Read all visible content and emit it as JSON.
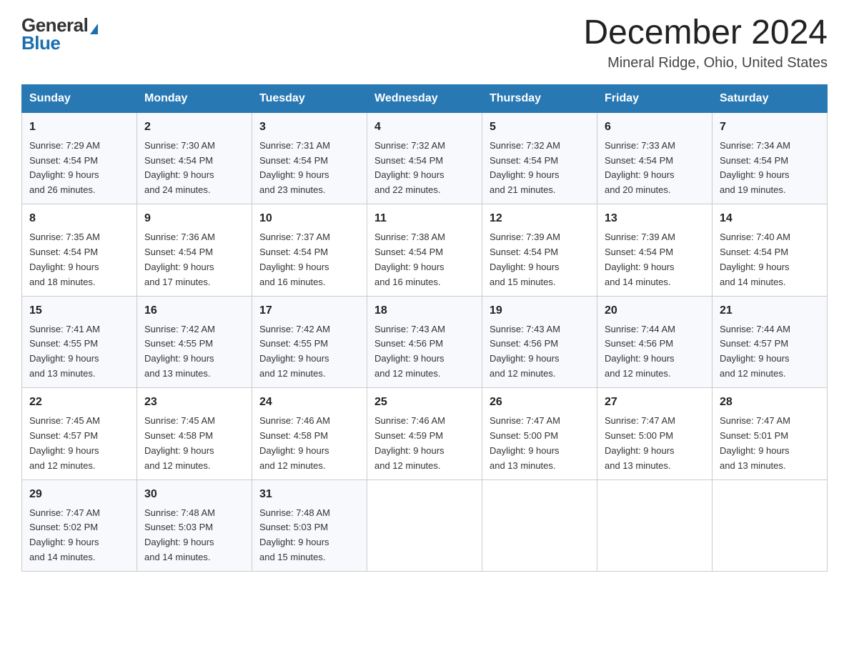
{
  "header": {
    "logo_general": "General",
    "logo_triangle": "▶",
    "logo_blue": "Blue",
    "month_title": "December 2024",
    "location": "Mineral Ridge, Ohio, United States"
  },
  "days_of_week": [
    "Sunday",
    "Monday",
    "Tuesday",
    "Wednesday",
    "Thursday",
    "Friday",
    "Saturday"
  ],
  "weeks": [
    [
      {
        "day": "1",
        "sunrise": "7:29 AM",
        "sunset": "4:54 PM",
        "daylight": "9 hours and 26 minutes."
      },
      {
        "day": "2",
        "sunrise": "7:30 AM",
        "sunset": "4:54 PM",
        "daylight": "9 hours and 24 minutes."
      },
      {
        "day": "3",
        "sunrise": "7:31 AM",
        "sunset": "4:54 PM",
        "daylight": "9 hours and 23 minutes."
      },
      {
        "day": "4",
        "sunrise": "7:32 AM",
        "sunset": "4:54 PM",
        "daylight": "9 hours and 22 minutes."
      },
      {
        "day": "5",
        "sunrise": "7:32 AM",
        "sunset": "4:54 PM",
        "daylight": "9 hours and 21 minutes."
      },
      {
        "day": "6",
        "sunrise": "7:33 AM",
        "sunset": "4:54 PM",
        "daylight": "9 hours and 20 minutes."
      },
      {
        "day": "7",
        "sunrise": "7:34 AM",
        "sunset": "4:54 PM",
        "daylight": "9 hours and 19 minutes."
      }
    ],
    [
      {
        "day": "8",
        "sunrise": "7:35 AM",
        "sunset": "4:54 PM",
        "daylight": "9 hours and 18 minutes."
      },
      {
        "day": "9",
        "sunrise": "7:36 AM",
        "sunset": "4:54 PM",
        "daylight": "9 hours and 17 minutes."
      },
      {
        "day": "10",
        "sunrise": "7:37 AM",
        "sunset": "4:54 PM",
        "daylight": "9 hours and 16 minutes."
      },
      {
        "day": "11",
        "sunrise": "7:38 AM",
        "sunset": "4:54 PM",
        "daylight": "9 hours and 16 minutes."
      },
      {
        "day": "12",
        "sunrise": "7:39 AM",
        "sunset": "4:54 PM",
        "daylight": "9 hours and 15 minutes."
      },
      {
        "day": "13",
        "sunrise": "7:39 AM",
        "sunset": "4:54 PM",
        "daylight": "9 hours and 14 minutes."
      },
      {
        "day": "14",
        "sunrise": "7:40 AM",
        "sunset": "4:54 PM",
        "daylight": "9 hours and 14 minutes."
      }
    ],
    [
      {
        "day": "15",
        "sunrise": "7:41 AM",
        "sunset": "4:55 PM",
        "daylight": "9 hours and 13 minutes."
      },
      {
        "day": "16",
        "sunrise": "7:42 AM",
        "sunset": "4:55 PM",
        "daylight": "9 hours and 13 minutes."
      },
      {
        "day": "17",
        "sunrise": "7:42 AM",
        "sunset": "4:55 PM",
        "daylight": "9 hours and 12 minutes."
      },
      {
        "day": "18",
        "sunrise": "7:43 AM",
        "sunset": "4:56 PM",
        "daylight": "9 hours and 12 minutes."
      },
      {
        "day": "19",
        "sunrise": "7:43 AM",
        "sunset": "4:56 PM",
        "daylight": "9 hours and 12 minutes."
      },
      {
        "day": "20",
        "sunrise": "7:44 AM",
        "sunset": "4:56 PM",
        "daylight": "9 hours and 12 minutes."
      },
      {
        "day": "21",
        "sunrise": "7:44 AM",
        "sunset": "4:57 PM",
        "daylight": "9 hours and 12 minutes."
      }
    ],
    [
      {
        "day": "22",
        "sunrise": "7:45 AM",
        "sunset": "4:57 PM",
        "daylight": "9 hours and 12 minutes."
      },
      {
        "day": "23",
        "sunrise": "7:45 AM",
        "sunset": "4:58 PM",
        "daylight": "9 hours and 12 minutes."
      },
      {
        "day": "24",
        "sunrise": "7:46 AM",
        "sunset": "4:58 PM",
        "daylight": "9 hours and 12 minutes."
      },
      {
        "day": "25",
        "sunrise": "7:46 AM",
        "sunset": "4:59 PM",
        "daylight": "9 hours and 12 minutes."
      },
      {
        "day": "26",
        "sunrise": "7:47 AM",
        "sunset": "5:00 PM",
        "daylight": "9 hours and 13 minutes."
      },
      {
        "day": "27",
        "sunrise": "7:47 AM",
        "sunset": "5:00 PM",
        "daylight": "9 hours and 13 minutes."
      },
      {
        "day": "28",
        "sunrise": "7:47 AM",
        "sunset": "5:01 PM",
        "daylight": "9 hours and 13 minutes."
      }
    ],
    [
      {
        "day": "29",
        "sunrise": "7:47 AM",
        "sunset": "5:02 PM",
        "daylight": "9 hours and 14 minutes."
      },
      {
        "day": "30",
        "sunrise": "7:48 AM",
        "sunset": "5:03 PM",
        "daylight": "9 hours and 14 minutes."
      },
      {
        "day": "31",
        "sunrise": "7:48 AM",
        "sunset": "5:03 PM",
        "daylight": "9 hours and 15 minutes."
      },
      null,
      null,
      null,
      null
    ]
  ],
  "labels": {
    "sunrise": "Sunrise:",
    "sunset": "Sunset:",
    "daylight": "Daylight:"
  }
}
